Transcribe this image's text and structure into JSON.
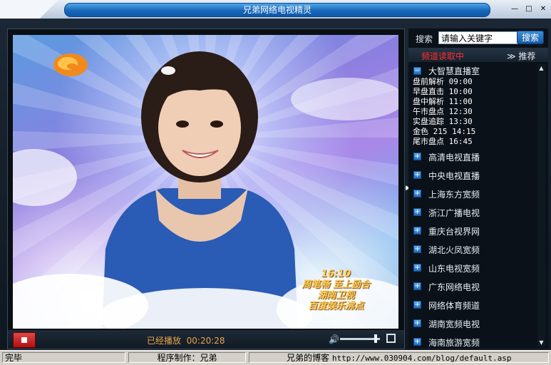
{
  "window": {
    "title": "兄弟网络电视精灵",
    "buttons": {
      "minimize": "—",
      "maximize": "□",
      "close": "✕"
    }
  },
  "video": {
    "caption_lines": [
      "16:10",
      "周笔畅 至上励合",
      "湖南卫视",
      "百度娱乐沸点"
    ],
    "logo": "mango-logo"
  },
  "controls": {
    "status_label": "已经播放",
    "elapsed": "00:20:28",
    "volume_fraction": 0.93
  },
  "sidebar": {
    "search": {
      "label": "搜索",
      "value": "请输入关键字",
      "button": "搜索"
    },
    "tabs": {
      "loading": "频道读取中",
      "recommend": "推荐"
    },
    "expanded_group": {
      "title": "大智慧直播室",
      "programs": [
        "盘前解析 09:00",
        "早盘直击 10:00",
        "盘中解析 11:00",
        "午市盘点 12:30",
        "实盘追踪 13:30",
        "金色 215 14:15",
        "尾市盘点 16:45"
      ]
    },
    "channels": [
      "高清电视直播",
      "中央电视直播",
      "上海东方宽频",
      "浙江广播电视",
      "重庆台视界网",
      "湖北火凤宽频",
      "山东电视宽频",
      "广东网络电视",
      "网络体育频道",
      "湖南宽频电视",
      "海南旅游宽频"
    ]
  },
  "statusbar": {
    "state": "完毕",
    "author": "程序制作：兄弟",
    "blog_label": "兄弟的博客",
    "blog_url": "http://www.030904.com/blog/default.asp"
  },
  "colors": {
    "title_pill": "#1766b8",
    "loading_tab": "#ff3030",
    "elapsed_text": "#e8a64a",
    "stop_button": "#c01818"
  }
}
